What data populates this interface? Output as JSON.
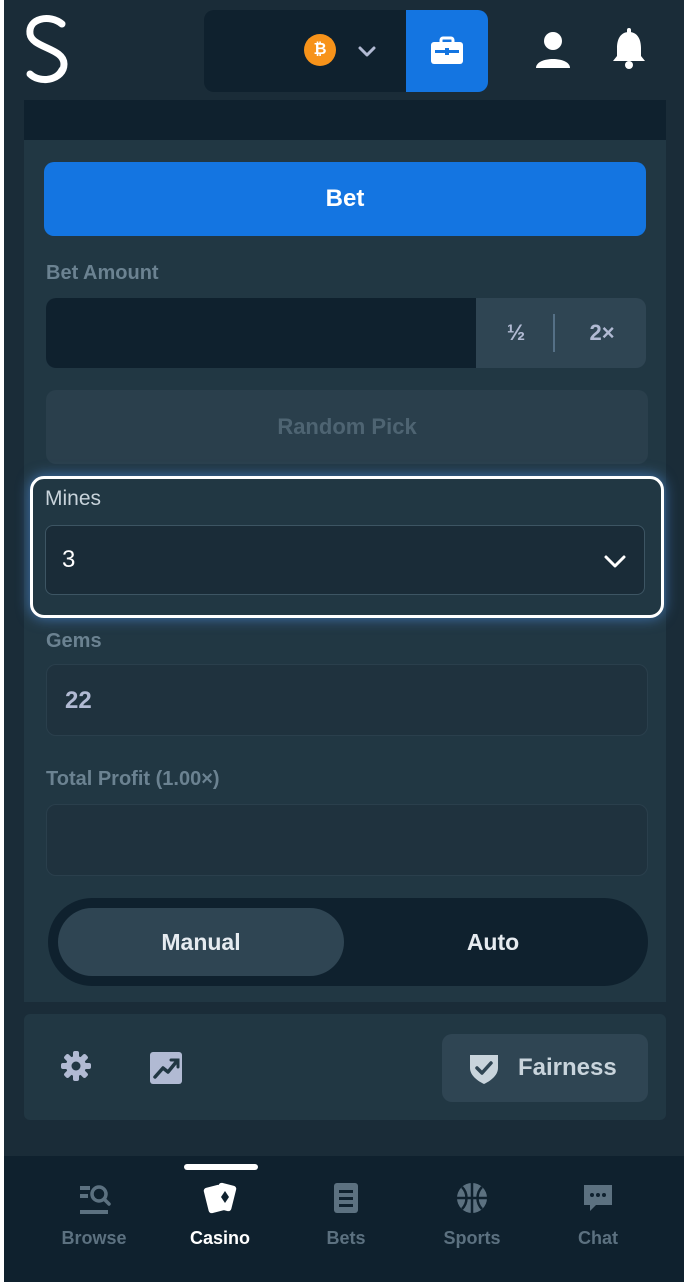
{
  "header": {
    "logo_text": "S",
    "currency": {
      "symbol": "₿",
      "icon": "bitcoin-icon",
      "color": "#f7931a"
    },
    "wallet_button_icon": "wallet-icon",
    "accent_color": "#1475e1"
  },
  "bet_panel": {
    "bet_button_label": "Bet",
    "bet_amount_label": "Bet Amount",
    "bet_amount_value": "",
    "half_label": "½",
    "double_label": "2×",
    "random_pick_label": "Random Pick",
    "mines_label": "Mines",
    "mines_value": "3",
    "gems_label": "Gems",
    "gems_value": "22",
    "total_profit_label": "Total Profit (1.00×)",
    "total_profit_value": "",
    "modes": {
      "manual": "Manual",
      "auto": "Auto",
      "selected": "Manual"
    }
  },
  "tools": {
    "settings_icon": "gear-icon",
    "stats_icon": "chart-icon",
    "fairness_label": "Fairness"
  },
  "bottom_nav": {
    "items": [
      {
        "label": "Browse",
        "icon": "browse-icon",
        "active": false
      },
      {
        "label": "Casino",
        "icon": "casino-icon",
        "active": true
      },
      {
        "label": "Bets",
        "icon": "bets-icon",
        "active": false
      },
      {
        "label": "Sports",
        "icon": "sports-icon",
        "active": false
      },
      {
        "label": "Chat",
        "icon": "chat-icon",
        "active": false
      }
    ]
  }
}
